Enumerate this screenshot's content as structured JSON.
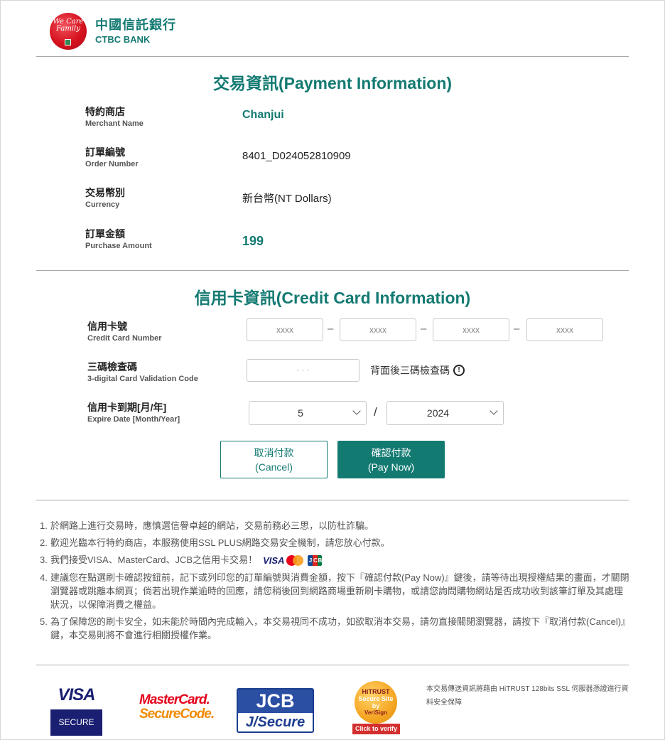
{
  "header": {
    "logo_zh": "中國信託銀行",
    "logo_en": "CTBC BANK",
    "logo_script": "We Care Family"
  },
  "payment_info": {
    "title": "交易資訊(Payment Information)",
    "rows": [
      {
        "label_zh": "特約商店",
        "label_en": "Merchant Name",
        "value": "Chanjui"
      },
      {
        "label_zh": "訂單編號",
        "label_en": "Order Number",
        "value": "8401_D024052810909"
      },
      {
        "label_zh": "交易幣別",
        "label_en": "Currency",
        "value": "新台幣(NT Dollars)"
      },
      {
        "label_zh": "訂單金額",
        "label_en": "Purchase Amount",
        "value": "199"
      }
    ]
  },
  "card_info": {
    "title": "信用卡資訊(Credit Card Information)",
    "card_number": {
      "label_zh": "信用卡號",
      "label_en": "Credit Card Number",
      "placeholders": [
        "xxxx",
        "xxxx",
        "xxxx",
        "xxxx"
      ],
      "separator": "–"
    },
    "cvv": {
      "label_zh": "三碼檢查碼",
      "label_en": "3-digital Card Validation Code",
      "placeholder": "· · ·",
      "hint": "背面後三碼檢查碼",
      "hint_icon": "exclamation-circle-icon"
    },
    "expiry": {
      "label_zh": "信用卡到期[月/年]",
      "label_en": "Expire Date [Month/Year]",
      "month": "5",
      "year": "2024",
      "separator": "/"
    }
  },
  "buttons": {
    "cancel_zh": "取消付款",
    "cancel_en": "(Cancel)",
    "pay_zh": "確認付款",
    "pay_en": "(Pay Now)"
  },
  "notes": [
    {
      "num": "1.",
      "text": "於網路上進行交易時，應慎選信譽卓越的網站，交易前務必三思，以防杜詐騙。"
    },
    {
      "num": "2.",
      "text": "歡迎光臨本行特約商店，本服務使用SSL PLUS網路交易安全機制，請您放心付款。"
    },
    {
      "num": "3.",
      "text": "我們接受VISA、MasterCard、JCB之信用卡交易！"
    },
    {
      "num": "4.",
      "text": "建議您在點選刷卡確認按鈕前，記下或列印您的訂單編號與消費金額，按下『確認付款(Pay Now)』鍵後，請等待出現授權結果的畫面，才關閉瀏覽器或跳離本網頁；倘若出現作業逾時的回應，請您稍後回到網路商場重新刷卡購物，或請您詢問購物網站是否成功收到該筆訂單及其處理狀況，以保障消費之權益。"
    },
    {
      "num": "5.",
      "text": "為了保障您的刷卡安全，如未能於時間內完成輸入，本交易視同不成功，如欲取消本交易，請勿直接關閉瀏覽器，請按下『取消付款(Cancel)』鍵，本交易則將不會進行相關授權作業。"
    }
  ],
  "mini_logos": {
    "visa": "VISA",
    "mastercard_icon": "mastercard-icon",
    "jcb_letters": [
      "J",
      "C",
      "B"
    ],
    "jcb_colors": [
      "#0e4c96",
      "#e2231a",
      "#007940"
    ]
  },
  "footer": {
    "visa_word": "VISA",
    "visa_secure": "SECURE",
    "mc_line1": "MasterCard.",
    "mc_line2": "SecureCode.",
    "jcb_top": "JCB",
    "jcb_bottom": "J/Secure",
    "hitrust_top": "HiTRUST",
    "hitrust_mid": "Secure Site",
    "hitrust_by": "by",
    "hitrust_brand": "VeriSign",
    "hitrust_verify": "Click to verify",
    "ssl_note": "本交易傳送資訊將藉由 HiTRUST 128bits SSL 伺服器憑證進行資料安全保障"
  },
  "colors": {
    "accent": "#137a72",
    "visa_blue": "#1a1f71",
    "mc_red": "#e3001b",
    "jcb_blue": "#2b4fa3"
  }
}
